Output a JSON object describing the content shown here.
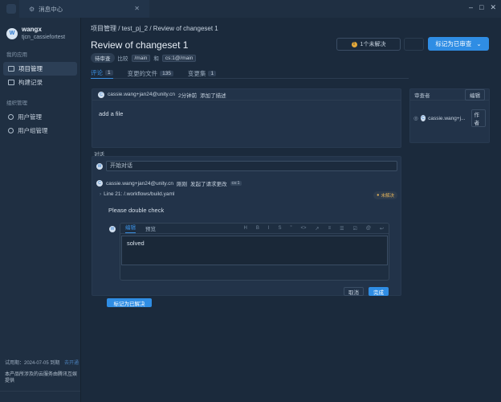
{
  "tabbar": {
    "tab_title": "消息中心"
  },
  "sidebar": {
    "user": {
      "name": "wangx",
      "group": "tjcn_cassiefortest",
      "avatar_letter": "W"
    },
    "section_my": "我的应用",
    "items_my": [
      {
        "label": "项目管理"
      },
      {
        "label": "构建记录"
      }
    ],
    "section_org": "组织管理",
    "items_org": [
      {
        "label": "用户管理"
      },
      {
        "label": "用户组管理"
      }
    ],
    "footer": {
      "trial_text": "试用期：2024-07-05 到期",
      "trial_link": "去开通",
      "notice": "本产品所涉及的云服务由腾讯互娱提供"
    }
  },
  "main": {
    "breadcrumb": "项目管理 / test_pj_2 / Review of changeset 1",
    "title": "Review of changeset 1",
    "meta": {
      "status": "待审查",
      "compare": "比较",
      "source": "/main",
      "and": "和",
      "target": "cs:1@/main"
    },
    "unresolved_btn": "1个未解决",
    "primary_btn": "标记为已审查",
    "subtabs": [
      {
        "label": "评论",
        "count": "1"
      },
      {
        "label": "变更的文件",
        "count": "135"
      },
      {
        "label": "变更集",
        "count": "1"
      }
    ],
    "description": {
      "author": "cassie.wang+jan24@unity.cn",
      "time": "2分钟前",
      "action": "添加了描述",
      "body": "add a file"
    },
    "reviewers": {
      "title": "审查者",
      "edit_btn": "编辑",
      "name": "cassie.wang+j...",
      "tag": "作者"
    },
    "conversation": {
      "label": "对话",
      "placeholder": "开始对话",
      "thread_author": "cassie.wang+jan24@unity.cn",
      "thread_time": "刚刚",
      "thread_action": "发起了请求更改",
      "thread_version": "cs:1",
      "file_line": "Line 21: /.workflows/build.yaml",
      "unresolved_badge": "未解决",
      "comment": "Please double check",
      "editor": {
        "tab_edit": "编辑",
        "tab_preview": "预览",
        "tools": [
          "H",
          "B",
          "I",
          "S",
          "”",
          "<>",
          "↗",
          "≡",
          "☰",
          "☑",
          "@",
          "↩"
        ],
        "content": "solved",
        "cancel": "取消",
        "done": "完成"
      },
      "resolve_btn": "标记为已解决"
    }
  },
  "colors": {
    "accent": "#2f8de4",
    "warning": "#e4a93a",
    "background": "#1b2a3c"
  }
}
